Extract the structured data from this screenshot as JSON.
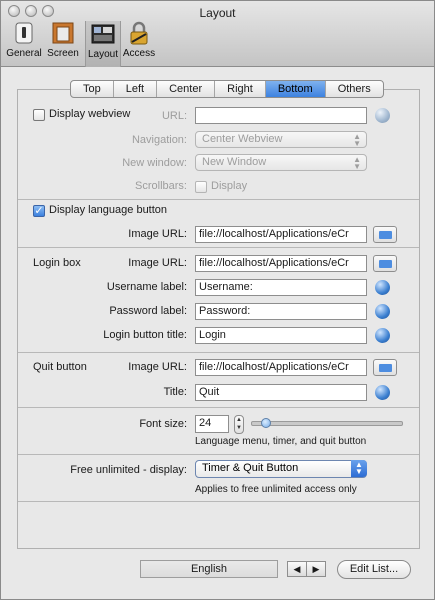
{
  "window": {
    "title": "Layout"
  },
  "toolbar": {
    "items": [
      {
        "label": "General",
        "icon": "switch-icon"
      },
      {
        "label": "Screen",
        "icon": "screen-icon"
      },
      {
        "label": "Layout",
        "icon": "layout-icon"
      },
      {
        "label": "Access",
        "icon": "lock-icon"
      }
    ],
    "selected": "Layout"
  },
  "tabs": {
    "items": [
      "Top",
      "Left",
      "Center",
      "Right",
      "Bottom",
      "Others"
    ],
    "selected": "Bottom"
  },
  "webview": {
    "checkbox_label": "Display webview",
    "checked": false,
    "url_label": "URL:",
    "url_value": "",
    "navigation_label": "Navigation:",
    "navigation_value": "Center Webview",
    "new_window_label": "New window:",
    "new_window_value": "New Window",
    "scrollbars_label": "Scrollbars:",
    "scrollbars_checkbox_label": "Display"
  },
  "language": {
    "checkbox_label": "Display language button",
    "checked": true,
    "image_url_label": "Image URL:",
    "image_url_value": "file://localhost/Applications/eCr"
  },
  "login": {
    "section_label": "Login box",
    "image_url_label": "Image URL:",
    "image_url_value": "file://localhost/Applications/eCr",
    "username_label": "Username label:",
    "username_value": "Username:",
    "password_label": "Password label:",
    "password_value": "Password:",
    "button_title_label": "Login button title:",
    "button_title_value": "Login"
  },
  "quit": {
    "section_label": "Quit button",
    "image_url_label": "Image URL:",
    "image_url_value": "file://localhost/Applications/eCr",
    "title_label": "Title:",
    "title_value": "Quit"
  },
  "font": {
    "label": "Font size:",
    "value": "24",
    "slider_fraction": 0.1,
    "note": "Language menu, timer, and quit button"
  },
  "free": {
    "label": "Free unlimited - display:",
    "value": "Timer & Quit Button",
    "note": "Applies to free unlimited access only"
  },
  "bottom": {
    "language": "English",
    "prev_symbol": "◀",
    "next_symbol": "▶",
    "edit_list_label": "Edit List..."
  },
  "colors": {
    "accent": "#3d82e0",
    "window_bg": "#e8e8e8"
  }
}
